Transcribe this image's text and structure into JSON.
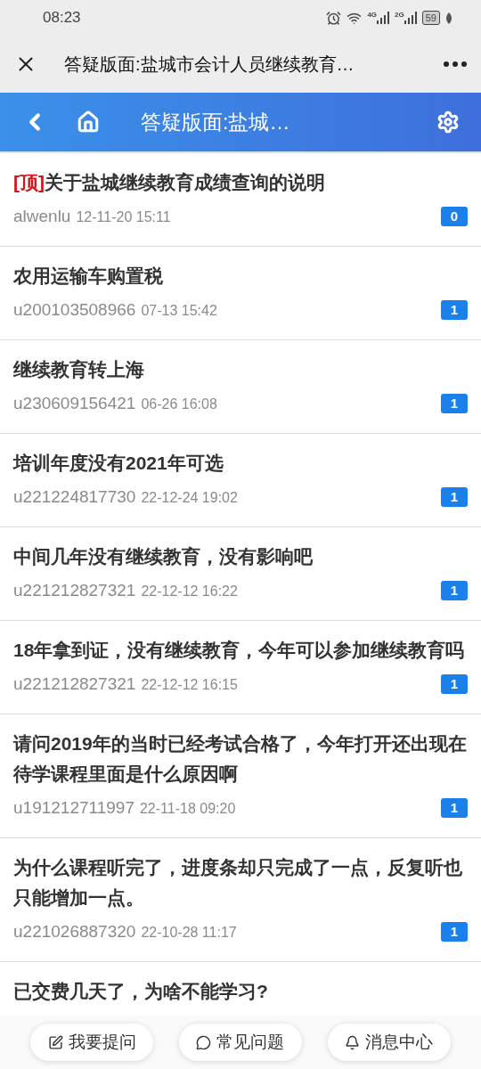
{
  "status_bar": {
    "time": "08:23",
    "network_1": "4G",
    "network_2": "2G",
    "battery": "59"
  },
  "browser_bar": {
    "title": "答疑版面:盐城市会计人员继续教育…"
  },
  "header": {
    "title": "答疑版面:盐城…"
  },
  "posts": [
    {
      "tag": "[顶]",
      "title": "关于盐城继续教育成绩查询的说明",
      "user": "alwenlu",
      "time": "12-11-20 15:11",
      "count": "0"
    },
    {
      "title": "农用运输车购置税",
      "user": "u200103508966",
      "time": "07-13 15:42",
      "count": "1"
    },
    {
      "title": "继续教育转上海",
      "user": "u230609156421",
      "time": "06-26 16:08",
      "count": "1"
    },
    {
      "title": "培训年度没有2021年可选",
      "user": "u221224817730",
      "time": "22-12-24 19:02",
      "count": "1"
    },
    {
      "title": "中间几年没有继续教育，没有影响吧",
      "user": "u221212827321",
      "time": "22-12-12 16:22",
      "count": "1"
    },
    {
      "title": "18年拿到证，没有继续教育，今年可以参加继续教育吗",
      "user": "u221212827321",
      "time": "22-12-12 16:15",
      "count": "1"
    },
    {
      "title": "请问2019年的当时已经考试合格了，今年打开还出现在待学课程里面是什么原因啊",
      "user": "u191212711997",
      "time": "22-11-18 09:20",
      "count": "1"
    },
    {
      "title": "为什么课程听完了，进度条却只完成了一点，反复听也只能增加一点。",
      "user": "u221026887320",
      "time": "22-10-28 11:17",
      "count": "1"
    },
    {
      "title": "已交费几天了，为啥不能学习?"
    }
  ],
  "bottom_nav": [
    {
      "kind": "ask",
      "label": "我要提问"
    },
    {
      "kind": "faq",
      "label": "常见问题"
    },
    {
      "kind": "messages",
      "label": "消息中心"
    }
  ]
}
